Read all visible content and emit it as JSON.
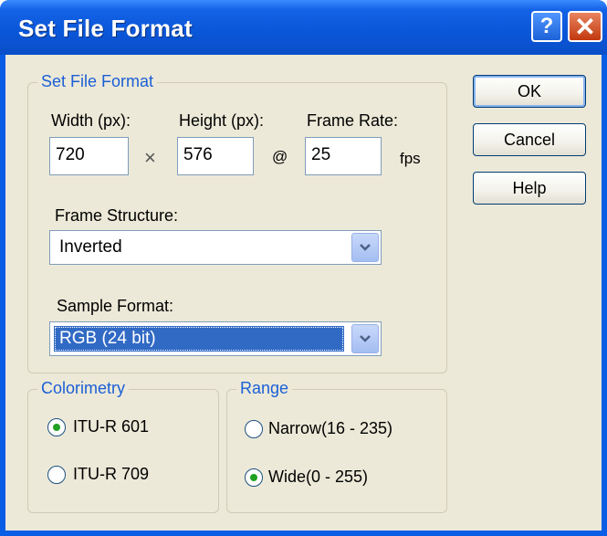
{
  "window": {
    "title": "Set File Format",
    "help_glyph": "?",
    "close_glyph": "✕"
  },
  "format_group": {
    "legend": "Set File Format",
    "width_label": "Width (px):",
    "width_value": "720",
    "times_glyph": "×",
    "height_label": "Height (px):",
    "height_value": "576",
    "at_glyph": "@",
    "frame_rate_label": "Frame Rate:",
    "frame_rate_value": "25",
    "fps_unit": "fps",
    "frame_structure_label": "Frame Structure:",
    "frame_structure_value": "Inverted",
    "sample_format_label": "Sample Format:",
    "sample_format_value": "RGB (24 bit)"
  },
  "colorimetry_group": {
    "legend": "Colorimetry",
    "options": [
      {
        "label": "ITU-R 601",
        "selected": true
      },
      {
        "label": "ITU-R 709",
        "selected": false
      }
    ]
  },
  "range_group": {
    "legend": "Range",
    "options": [
      {
        "label": "Narrow(16 - 235)",
        "selected": false
      },
      {
        "label": "Wide(0 - 255)",
        "selected": true
      }
    ]
  },
  "buttons": {
    "ok": "OK",
    "cancel": "Cancel",
    "help": "Help"
  },
  "colors": {
    "titlebar": "#0a56d8",
    "dialog_bg": "#ece9d8",
    "group_legend": "#1c5fd6",
    "selection": "#316ac5",
    "radio_dot": "#21a121"
  },
  "icons": {
    "help": "help-icon",
    "close": "close-icon",
    "dropdown": "chevron-down-icon"
  }
}
